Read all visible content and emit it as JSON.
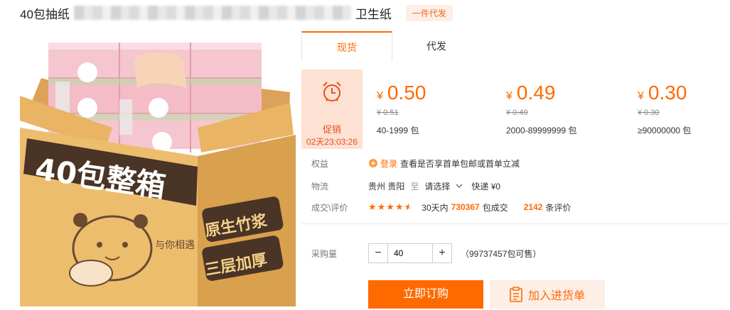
{
  "title": {
    "left": "40包抽纸",
    "right": "卫生纸",
    "badge": "一件代发"
  },
  "product": {
    "box_text": "40包整箱",
    "tag1": "原生竹浆",
    "tag2": "三层加厚",
    "handwriting": "与你相遇"
  },
  "tabs": [
    {
      "label": "现货"
    },
    {
      "label": "代发"
    }
  ],
  "promo": {
    "label": "促销",
    "timer": "02天23:03:26",
    "icon": "alarm-clock-icon"
  },
  "tiers": [
    {
      "currency": "¥",
      "price": "0.50",
      "old": "¥ 0.51",
      "range": "40-1999 包"
    },
    {
      "currency": "¥",
      "price": "0.49",
      "old": "¥ 0.49",
      "range": "2000-89999999 包"
    },
    {
      "currency": "¥",
      "price": "0.30",
      "old": "¥ 0.30",
      "range": "≥90000000 包"
    }
  ],
  "benefits": {
    "key": "权益",
    "login": "登录",
    "text": "查看是否享首单包邮或首单立减"
  },
  "logistics": {
    "key": "物流",
    "origin": "贵州 贵阳",
    "to": "至",
    "select": "请选择",
    "express": "快递 ¥0"
  },
  "reviews": {
    "key": "成交\\评价",
    "rating": 4.5,
    "period": "30天内",
    "sold": "730367",
    "sold_unit": "包成交",
    "count": "2142",
    "count_unit": "条评价"
  },
  "purchase": {
    "key": "采购量",
    "minus": "−",
    "plus": "+",
    "value": "40",
    "available": "（99737457包可售）"
  },
  "actions": {
    "buy": "立即订购",
    "cart": "加入进货单"
  },
  "colors": {
    "accent": "#ff6a00",
    "promo_bg": "#fde1d3",
    "cart_bg": "#fdeee6",
    "box": "#e9b463"
  }
}
